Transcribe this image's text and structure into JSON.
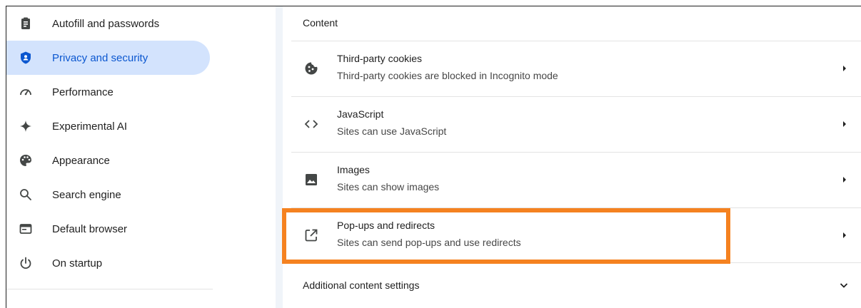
{
  "sidebar": {
    "items": [
      {
        "label": "Autofill and passwords",
        "icon": "clipboard-icon"
      },
      {
        "label": "Privacy and security",
        "icon": "shield-icon",
        "active": true
      },
      {
        "label": "Performance",
        "icon": "speedometer-icon"
      },
      {
        "label": "Experimental AI",
        "icon": "sparkle-icon"
      },
      {
        "label": "Appearance",
        "icon": "palette-icon"
      },
      {
        "label": "Search engine",
        "icon": "search-icon"
      },
      {
        "label": "Default browser",
        "icon": "browser-icon"
      },
      {
        "label": "On startup",
        "icon": "power-icon"
      }
    ]
  },
  "content": {
    "section_title": "Content",
    "rows": [
      {
        "title": "Third-party cookies",
        "subtitle": "Third-party cookies are blocked in Incognito mode",
        "icon": "cookie-icon"
      },
      {
        "title": "JavaScript",
        "subtitle": "Sites can use JavaScript",
        "icon": "code-icon"
      },
      {
        "title": "Images",
        "subtitle": "Sites can show images",
        "icon": "image-icon"
      },
      {
        "title": "Pop-ups and redirects",
        "subtitle": "Sites can send pop-ups and use redirects",
        "icon": "open-in-new-icon",
        "highlighted": true
      }
    ],
    "additional_label": "Additional content settings"
  },
  "colors": {
    "accent": "#0b57d0",
    "active_bg": "#d3e3fd",
    "highlight": "#f58220"
  }
}
